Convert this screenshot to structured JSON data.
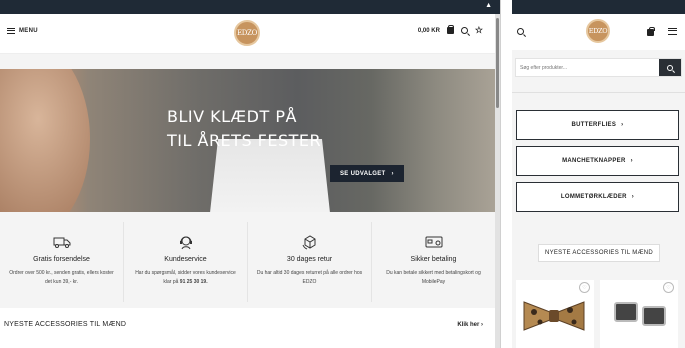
{
  "desktop": {
    "header": {
      "menu_label": "MENU",
      "logo_text": "EDZO",
      "cart_total": "0,00 KR"
    },
    "hero": {
      "line1": "BLIV KLÆDT PÅ",
      "line2": "TIL ÅRETS FESTER",
      "cta_label": "SE UDVALGET",
      "cta_arrow": "›"
    },
    "usps": [
      {
        "icon": "truck-icon",
        "title": "Gratis forsendelse",
        "desc": "Ordrer over 500 kr., senden gratis, ellers koster det kun 39,- kr.",
        "desc_bold": ""
      },
      {
        "icon": "headset-icon",
        "title": "Kundeservice",
        "desc": "Har du spørgsmål, sidder vores kundeservice klar på",
        "desc_bold": "91 25 30 19."
      },
      {
        "icon": "return-box-icon",
        "title": "30 dages retur",
        "desc": "Du har altid 30 dages returret på alle ordrer hos EDZO",
        "desc_bold": ""
      },
      {
        "icon": "card-icon",
        "title": "Sikker betaling",
        "desc": "Du kan betale sikkert med betalingskort og MobilePay",
        "desc_bold": ""
      }
    ],
    "section": {
      "heading": "NYESTE ACCESSORIES TIL MÆND",
      "link_label": "Klik her",
      "link_arrow": "›"
    }
  },
  "mobile": {
    "logo_text": "EDZO",
    "search_placeholder": "Søg efter produkter...",
    "categories": [
      {
        "label": "BUTTERFLIES",
        "arrow": "›"
      },
      {
        "label": "MANCHETKNAPPER",
        "arrow": "›"
      },
      {
        "label": "LOMMETØRKLÆDER",
        "arrow": "›"
      }
    ],
    "newest_heading": "NYESTE ACCESSORIES TIL MÆND"
  },
  "colors": {
    "dark": "#1f2a36",
    "logo_gold": "#c7945e",
    "button_dark": "#1c2430"
  }
}
